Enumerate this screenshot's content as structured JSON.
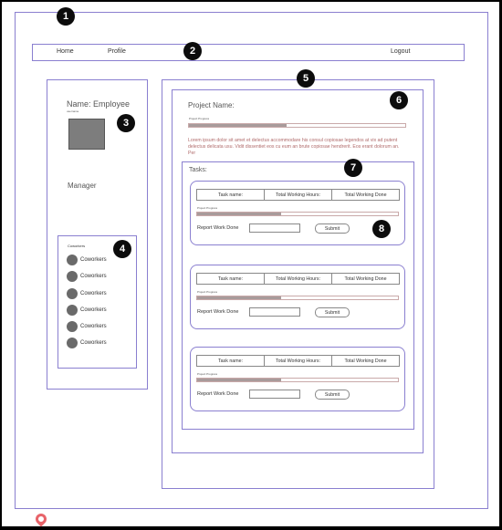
{
  "nav": {
    "home": "Home",
    "profile": "Profile",
    "logout": "Logout"
  },
  "badges": [
    "1",
    "2",
    "3",
    "4",
    "5",
    "6",
    "7",
    "8"
  ],
  "sidebar": {
    "name": "Name: Employee",
    "name_sub": "username",
    "role": "Manager",
    "coworkers_title": "Coworkers",
    "coworkers": [
      "Coworkers",
      "Coworkers",
      "Coworkers",
      "Coworkers",
      "Coworkers",
      "Coworkers"
    ]
  },
  "project": {
    "name_label": "Project Name:",
    "progress_label": "Project Progress",
    "progress": 0.45,
    "description": "Lorem ipsum dolor sit amet et delectus accommodare his consul copiosae legendos at vix ad putent delectus delicata usu. Vidit dissentiet eos cu eum an brute copiosae hendrerit. Eos erant dolorum an. Per",
    "tasks_label": "Tasks:"
  },
  "task_headers": [
    "Task name:",
    "Total Working Hours:",
    "Total Working Done"
  ],
  "tasks": [
    {
      "progress_label": "Project Progress",
      "progress": 0.42,
      "report_label": "Report Work Done",
      "submit": "Submit"
    },
    {
      "progress_label": "Project Progress",
      "progress": 0.42,
      "report_label": "Report Work Done",
      "submit": "Submit"
    },
    {
      "progress_label": "Project Progress",
      "progress": 0.42,
      "report_label": "Report Work Done",
      "submit": "Submit"
    }
  ],
  "colors": {
    "border": "#8a7fd0",
    "progress_fill": "#a89b9b",
    "lorem_text": "#b06a6a",
    "badge": "#0c0c0c"
  },
  "icons": {
    "avatar": "avatar-icon",
    "coworker": "user-icon",
    "pin": "map-pin-icon"
  }
}
